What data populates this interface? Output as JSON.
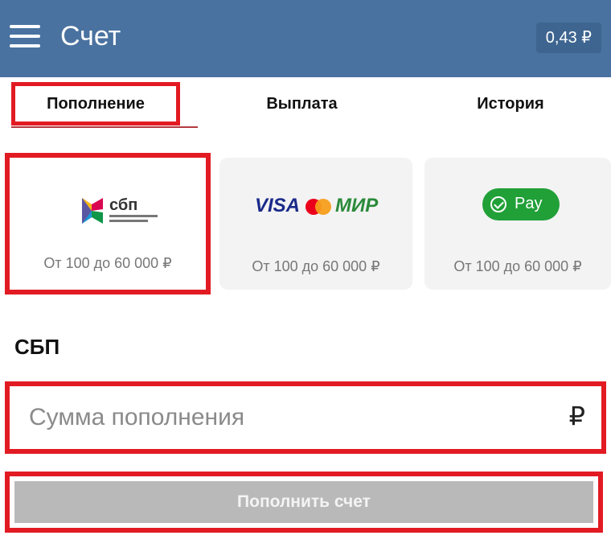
{
  "header": {
    "title": "Счет",
    "balance": "0,43 ₽"
  },
  "tabs": [
    {
      "label": "Пополнение",
      "active": true
    },
    {
      "label": "Выплата",
      "active": false
    },
    {
      "label": "История",
      "active": false
    }
  ],
  "methods": [
    {
      "name": "sbp",
      "logo_text": "сбп",
      "range": "От 100 до 60 000 ₽",
      "selected": true
    },
    {
      "name": "cards",
      "logo_visa": "VISA",
      "logo_mir": "МИР",
      "range": "От 100 до 60 000 ₽",
      "selected": false
    },
    {
      "name": "spay",
      "logo_text": "Pay",
      "range": "От 100 до 60 000 ₽",
      "selected": false
    }
  ],
  "section": {
    "title": "СБП"
  },
  "amount": {
    "placeholder": "Сумма пополнения",
    "value": "",
    "currency": "₽"
  },
  "submit": {
    "label": "Пополнить счет",
    "enabled": false
  },
  "colors": {
    "header": "#4a72a0",
    "highlight": "#e21b23",
    "sber_green": "#21a038",
    "button_disabled": "#b9b9b9"
  }
}
